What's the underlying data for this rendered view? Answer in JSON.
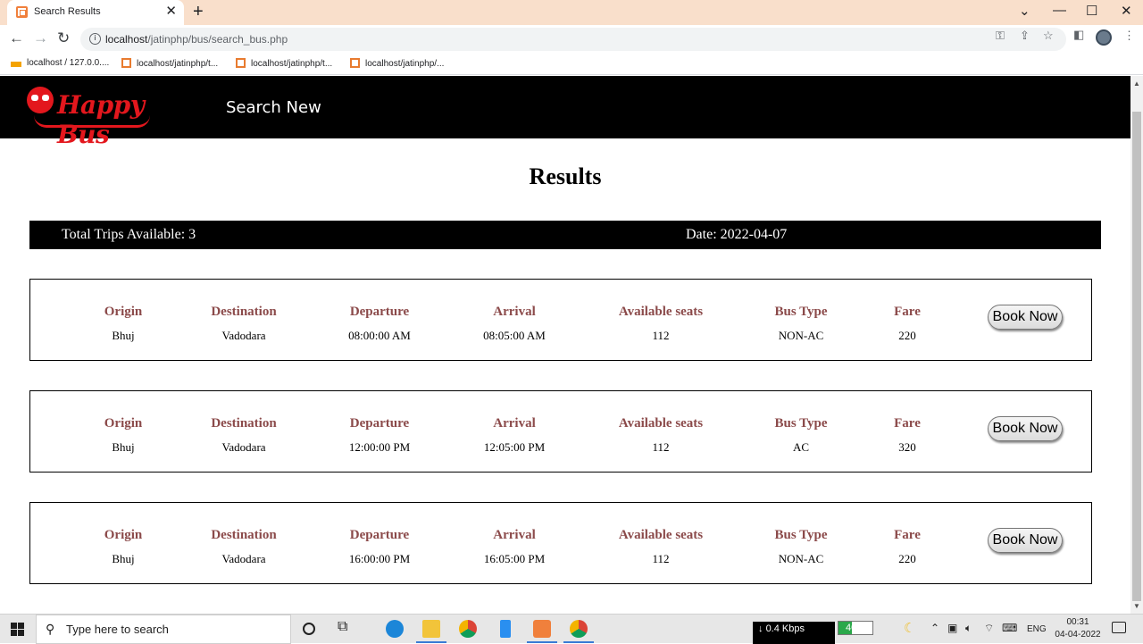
{
  "browser": {
    "tab_title": "Search Results",
    "tab_close": "✕",
    "new_tab": "+",
    "url_host": "localhost",
    "url_path": "/jatinphp/bus/search_bus.php",
    "bookmarks": [
      "localhost / 127.0.0....",
      "localhost/jatinphp/t...",
      "localhost/jatinphp/t...",
      "localhost/jatinphp/..."
    ]
  },
  "header": {
    "logo_text": "Happy Bus",
    "nav_link": "Search New"
  },
  "results": {
    "title": "Results",
    "total_trips": "Total Trips Available: 3",
    "date": "Date: 2022-04-07"
  },
  "columns": [
    "Origin",
    "Destination",
    "Departure",
    "Arrival",
    "Available seats",
    "Bus Type",
    "Fare"
  ],
  "book_label": "Book Now",
  "trips": [
    {
      "origin": "Bhuj",
      "destination": "Vadodara",
      "departure": "08:00:00 AM",
      "arrival": "08:05:00 AM",
      "seats": "112",
      "bus_type": "NON-AC",
      "fare": "220"
    },
    {
      "origin": "Bhuj",
      "destination": "Vadodara",
      "departure": "12:00:00 PM",
      "arrival": "12:05:00 PM",
      "seats": "112",
      "bus_type": "AC",
      "fare": "320"
    },
    {
      "origin": "Bhuj",
      "destination": "Vadodara",
      "departure": "16:00:00 PM",
      "arrival": "16:05:00 PM",
      "seats": "112",
      "bus_type": "NON-AC",
      "fare": "220"
    }
  ],
  "taskbar": {
    "search_placeholder": "Type here to search",
    "net_speed": "0.4 Kbps",
    "battery": "40%",
    "battery_level": 0.4,
    "lang": "ENG",
    "time": "00:31",
    "date": "04-04-2022"
  },
  "colors": {
    "tab_strip": "#f9dfcb",
    "header_bg": "#000000",
    "logo_red": "#e3171d",
    "column_header": "#8b4a4a"
  }
}
